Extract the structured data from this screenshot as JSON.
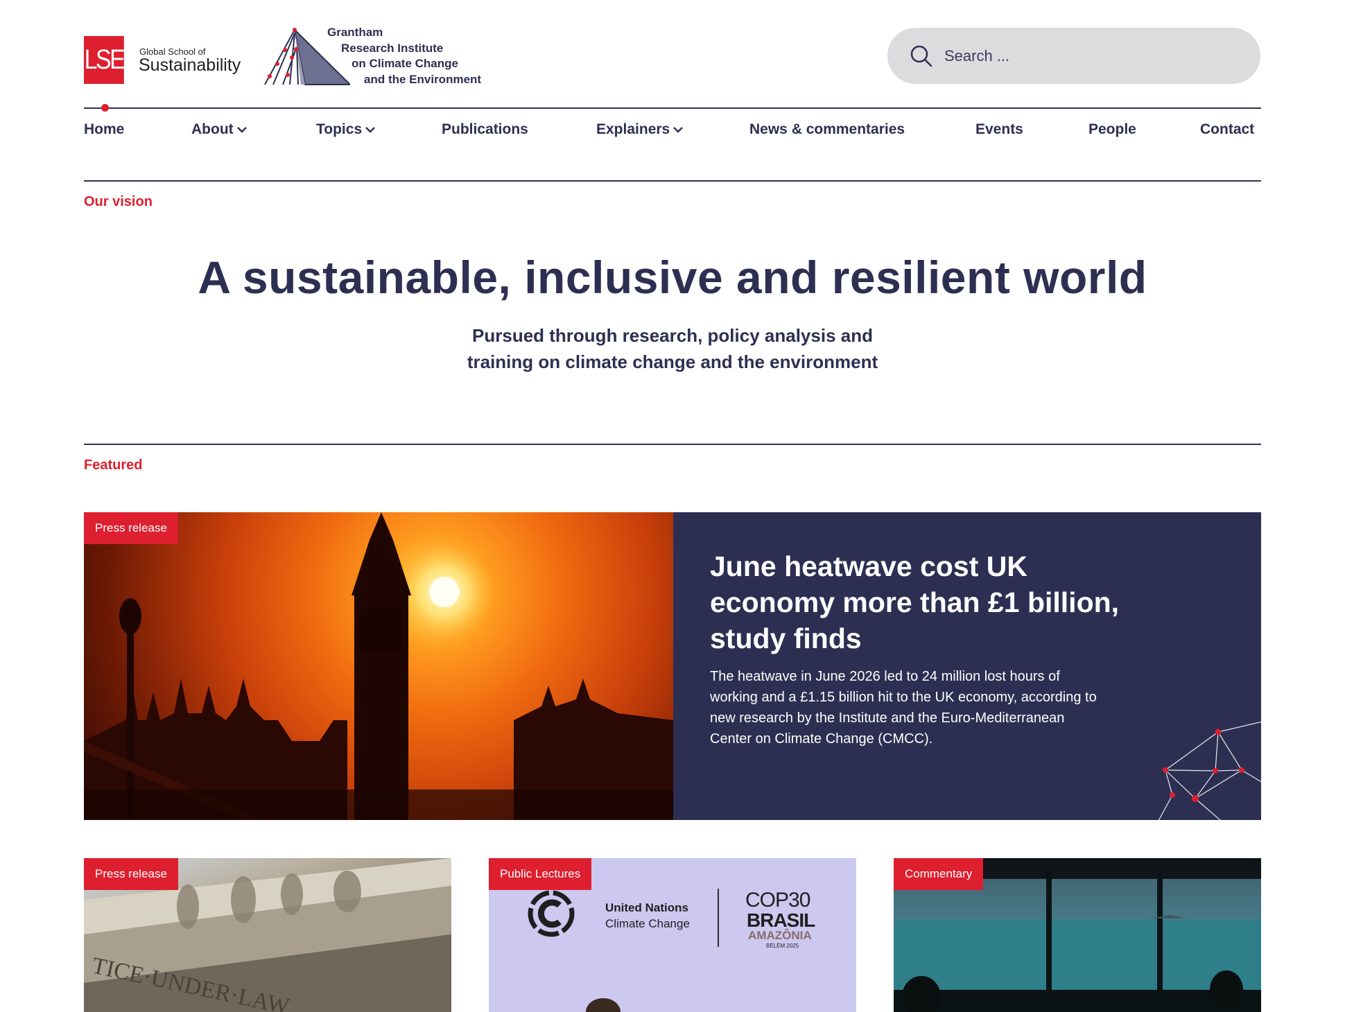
{
  "header": {
    "lse_logo": "LSE",
    "lse_small": "Global School of",
    "lse_big": "Sustainability",
    "grantham_lines": [
      "Grantham",
      "Research Institute",
      "on Climate Change",
      "and the Environment"
    ],
    "search_placeholder": "Search ..."
  },
  "nav": {
    "home": "Home",
    "about": "About",
    "topics": "Topics",
    "publications": "Publications",
    "explainers": "Explainers",
    "news": "News & commentaries",
    "events": "Events",
    "people": "People",
    "contact": "Contact"
  },
  "vision": {
    "label": "Our vision",
    "title": "A sustainable, inclusive and resilient world",
    "subtitle_lines": [
      "Pursued through research, policy analysis and",
      "training on climate change and the environment"
    ]
  },
  "featured": {
    "label": "Featured",
    "main": {
      "badge": "Press release",
      "title_lines": [
        "June heatwave cost UK",
        "economy more than £1 billion,",
        "study finds"
      ],
      "desc_lines": [
        "The heatwave in June 2026 led to 24 million lost hours of",
        "working and a £1.15 billion hit to the UK economy, according to",
        "new research by the Institute and the Euro-Mediterranean",
        "Center on Climate Change (CMCC)."
      ]
    },
    "cards": [
      {
        "badge": "Press release",
        "image_text": "TICE·UNDER·LAW"
      },
      {
        "badge": "Public Lectures",
        "un_line1": "United Nations",
        "un_line2": "Climate Change",
        "cop_line1": "COP30",
        "cop_line2": "BRASIL",
        "cop_line3": "AMAZÔNIA",
        "cop_line4": "BELÉM 2025"
      },
      {
        "badge": "Commentary"
      }
    ]
  },
  "colors": {
    "brand_red": "#dd1f2f",
    "navy": "#2d2f52"
  }
}
